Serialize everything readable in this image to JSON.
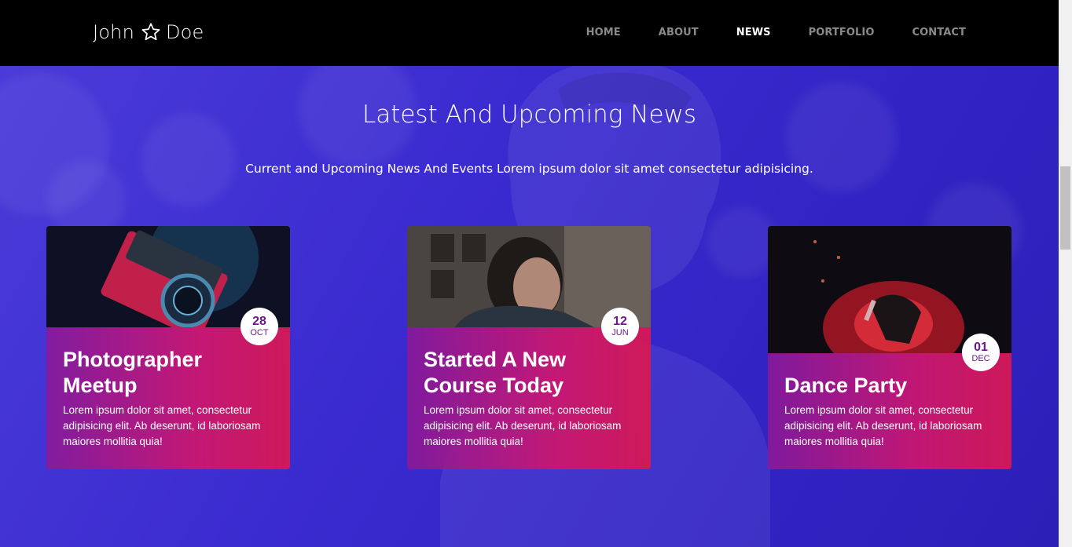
{
  "brand": {
    "first": "John",
    "last": "Doe",
    "icon": "star-outline-icon"
  },
  "nav": {
    "items": [
      {
        "label": "HOME",
        "active": false
      },
      {
        "label": "ABOUT",
        "active": false
      },
      {
        "label": "NEWS",
        "active": true
      },
      {
        "label": "PORTFOLIO",
        "active": false
      },
      {
        "label": "CONTACT",
        "active": false
      }
    ]
  },
  "news": {
    "title": "Latest And Upcoming News",
    "subtitle": "Current and Upcoming News And Events Lorem ipsum dolor sit amet consectetur adipisicing.",
    "cards": [
      {
        "day": "28",
        "month": "OCT",
        "title_line1": "Photographer",
        "title_line2": "Meetup",
        "desc": "Lorem ipsum dolor sit amet, consectetur adipisicing elit. Ab deserunt, id laboriosam maiores mollitia quia!"
      },
      {
        "day": "12",
        "month": "JUN",
        "title_line1": "Started A New",
        "title_line2": "Course Today",
        "desc": "Lorem ipsum dolor sit amet, consectetur adipisicing elit. Ab deserunt, id laboriosam maiores mollitia quia!"
      },
      {
        "day": "01",
        "month": "DEC",
        "title_line1": "Dance Party",
        "title_line2": "",
        "desc": "Lorem ipsum dolor sit amet, consectetur adipisicing elit. Ab deserunt, id laboriosam maiores mollitia quia!"
      }
    ]
  },
  "colors": {
    "overlay": "#3a2bd0",
    "card_gradient_start": "#8c1896",
    "card_gradient_end": "#d61854",
    "date_text": "#6a1a88"
  }
}
